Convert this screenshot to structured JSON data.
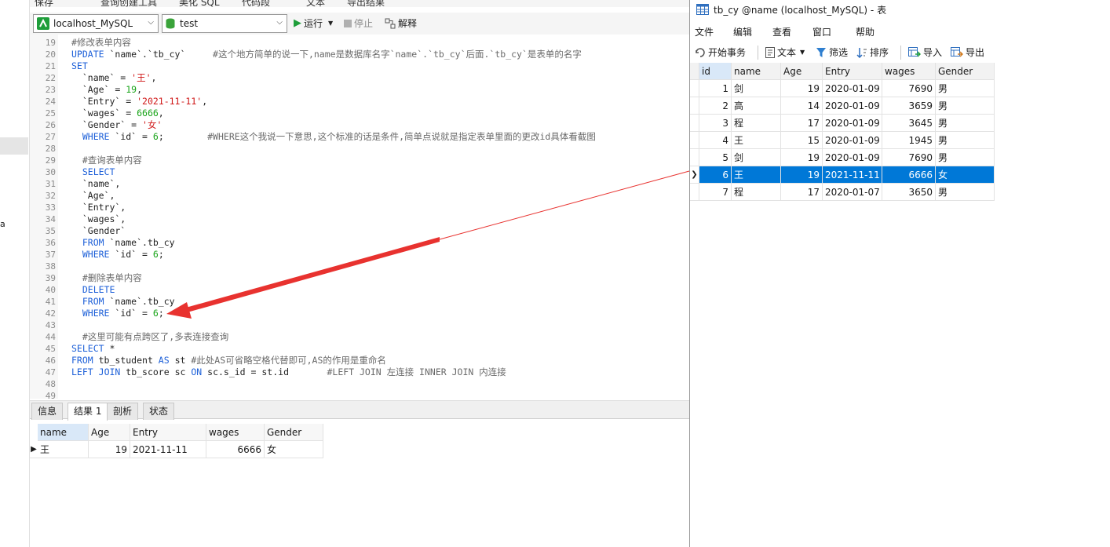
{
  "top_toolbar": {
    "items": [
      "保存",
      "查询创建工具",
      "美化 SQL",
      "代码段",
      "文本",
      "导出结果"
    ]
  },
  "connection_bar": {
    "connection": "localhost_MySQL",
    "database": "test",
    "run_label": "运行",
    "stop_label": "停止",
    "explain_label": "解释"
  },
  "left_strip": {
    "text": "a"
  },
  "editor": {
    "lines": [
      {
        "n": "19",
        "code": "#修改表单内容"
      },
      {
        "n": "20",
        "code": "UPDATE `name`.`tb_cy`     #这个地方简单的说一下,name是数据库名字`name`.`tb_cy`后面.`tb_cy`是表单的名字"
      },
      {
        "n": "21",
        "code": "SET"
      },
      {
        "n": "22",
        "code": "  `name` = '王',"
      },
      {
        "n": "23",
        "code": "  `Age` = 19,"
      },
      {
        "n": "24",
        "code": "  `Entry` = '2021-11-11',"
      },
      {
        "n": "25",
        "code": "  `wages` = 6666,"
      },
      {
        "n": "26",
        "code": "  `Gender` = '女'"
      },
      {
        "n": "27",
        "code": "  WHERE `id` = 6;        #WHERE这个我说一下意思,这个标准的话是条件,简单点说就是指定表单里面的更改id具体看截图"
      },
      {
        "n": "28",
        "code": ""
      },
      {
        "n": "29",
        "code": "  #查询表单内容"
      },
      {
        "n": "30",
        "code": "  SELECT"
      },
      {
        "n": "31",
        "code": "  `name`,"
      },
      {
        "n": "32",
        "code": "  `Age`,"
      },
      {
        "n": "33",
        "code": "  `Entry`,"
      },
      {
        "n": "34",
        "code": "  `wages`,"
      },
      {
        "n": "35",
        "code": "  `Gender`"
      },
      {
        "n": "36",
        "code": "  FROM `name`.tb_cy"
      },
      {
        "n": "37",
        "code": "  WHERE `id` = 6;"
      },
      {
        "n": "38",
        "code": ""
      },
      {
        "n": "39",
        "code": "  #删除表单内容"
      },
      {
        "n": "40",
        "code": "  DELETE"
      },
      {
        "n": "41",
        "code": "  FROM `name`.tb_cy"
      },
      {
        "n": "42",
        "code": "  WHERE `id` = 6;"
      },
      {
        "n": "43",
        "code": ""
      },
      {
        "n": "44",
        "code": "  #这里可能有点跨区了,多表连接查询"
      },
      {
        "n": "45",
        "code": "SELECT *"
      },
      {
        "n": "46",
        "code": "FROM tb_student AS st #此处AS可省略空格代替即可,AS的作用是重命名"
      },
      {
        "n": "47",
        "code": "LEFT JOIN tb_score sc ON sc.s_id = st.id       #LEFT JOIN 左连接 INNER JOIN 内连接"
      },
      {
        "n": "48",
        "code": ""
      },
      {
        "n": "49",
        "code": ""
      }
    ]
  },
  "bottom_tabs": [
    "信息",
    "结果 1",
    "剖析",
    "状态"
  ],
  "result": {
    "columns": [
      "name",
      "Age",
      "Entry",
      "wages",
      "Gender"
    ],
    "row": [
      "王",
      "19",
      "2021-11-11",
      "6666",
      "女"
    ]
  },
  "table_window": {
    "title": "tb_cy @name (localhost_MySQL) - 表",
    "menu": [
      "文件",
      "编辑",
      "查看",
      "窗口",
      "帮助"
    ],
    "toolbar": [
      "开始事务",
      "文本",
      "筛选",
      "排序",
      "导入",
      "导出"
    ],
    "columns": [
      "id",
      "name",
      "Age",
      "Entry",
      "wages",
      "Gender"
    ],
    "rows": [
      [
        "1",
        "剑",
        "19",
        "2020-01-09",
        "7690",
        "男"
      ],
      [
        "2",
        "高",
        "14",
        "2020-01-09",
        "3659",
        "男"
      ],
      [
        "3",
        "程",
        "17",
        "2020-01-09",
        "3645",
        "男"
      ],
      [
        "4",
        "王",
        "15",
        "2020-01-09",
        "1945",
        "男"
      ],
      [
        "5",
        "剑",
        "19",
        "2020-01-09",
        "7690",
        "男"
      ],
      [
        "6",
        "王",
        "19",
        "2021-11-11",
        "6666",
        "女"
      ],
      [
        "7",
        "程",
        "17",
        "2020-01-07",
        "3650",
        "男"
      ]
    ],
    "selected_row": 5
  },
  "colors": {
    "keyword": "#1c5fd8",
    "comment": "#6a6a6a",
    "string": "#d01818",
    "number": "#17a317",
    "selection": "#0078d7",
    "arrow": "#e8322f"
  }
}
